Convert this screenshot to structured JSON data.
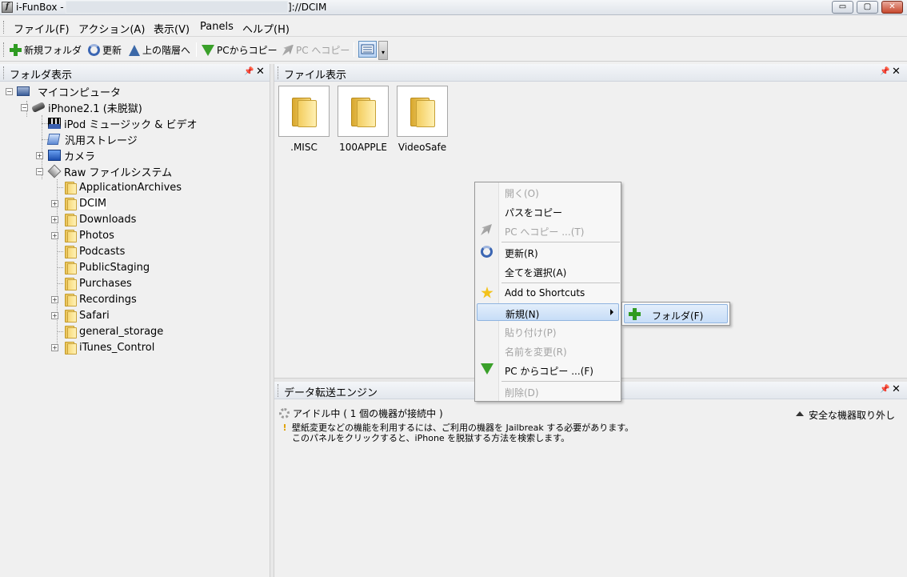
{
  "window": {
    "title_prefix": "i-FunBox -",
    "title_suffix": "]://DCIM",
    "app_icon_letter": "f",
    "min_glyph": "▭",
    "max_glyph": "▢",
    "close_glyph": "✕"
  },
  "menubar": {
    "items": [
      "ファイル(F)",
      "アクション(A)",
      "表示(V)",
      "Panels",
      "ヘルプ(H)"
    ]
  },
  "toolbar": {
    "new_folder": "新規フォルダ",
    "refresh": "更新",
    "up": "上の階層へ",
    "copy_from_pc": "PCからコピー",
    "copy_to_pc": "PC へコピー",
    "dropdown_glyph": "▾"
  },
  "folder_panel": {
    "title": "フォルダ表示",
    "pin": "📌",
    "close": "✕",
    "tree": {
      "my_computer": "マイコンピュータ",
      "device": "iPhone2.1 (未脱獄)",
      "ipod": "iPod ミュージック & ビデオ",
      "storage": "汎用ストレージ",
      "camera": "カメラ",
      "raw_fs": "Raw ファイルシステム",
      "folders": [
        "ApplicationArchives",
        "DCIM",
        "Downloads",
        "Photos",
        "Podcasts",
        "PublicStaging",
        "Purchases",
        "Recordings",
        "Safari",
        "general_storage",
        "iTunes_Control"
      ]
    }
  },
  "files_panel": {
    "title": "ファイル表示",
    "pin": "📌",
    "close": "✕",
    "items": [
      ".MISC",
      "100APPLE",
      "VideoSafe"
    ]
  },
  "context_menu": {
    "open": "開く(O)",
    "copy_path": "パスをコピー",
    "copy_to_pc": "PC へコピー ...(T)",
    "refresh": "更新(R)",
    "select_all": "全てを選択(A)",
    "add_shortcut": "Add to Shortcuts",
    "new": "新規(N)",
    "paste": "貼り付け(P)",
    "rename": "名前を変更(R)",
    "copy_from_pc": "PC からコピー ...(F)",
    "delete": "削除(D)"
  },
  "submenu": {
    "folder": "フォルダ(F)"
  },
  "transfer_panel": {
    "title": "データ転送エンジン",
    "pin": "📌",
    "close": "✕",
    "status": "アイドル中 ( 1 個の機器が接続中 )",
    "eject": "安全な機器取り外し",
    "warning_glyph": "!",
    "warning_line1": "壁紙変更などの機能を利用するには、ご利用の機器を Jailbreak する必要があります。",
    "warning_line2": "このパネルをクリックすると、iPhone を脱獄する方法を検索します。"
  },
  "colors": {
    "accent": "#3399ff",
    "highlight": "#c7ddf7",
    "panel": "#f0f0f0"
  }
}
